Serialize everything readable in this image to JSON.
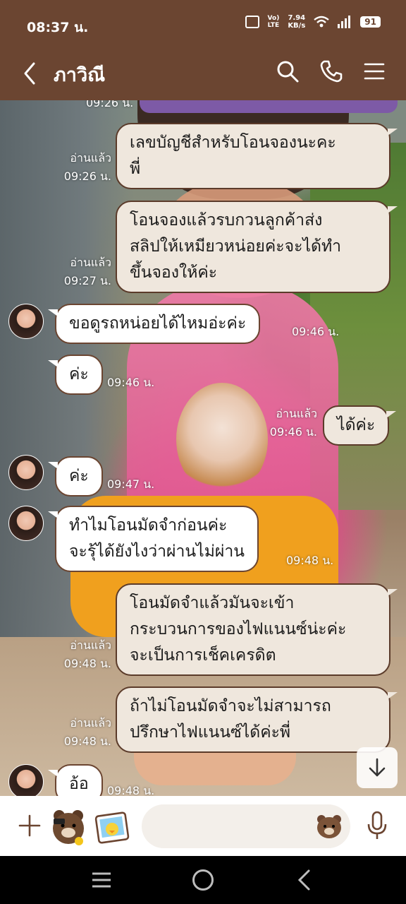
{
  "status_bar": {
    "time": "08:37 น.",
    "volte_top": "Vo)",
    "volte_bottom": "LTE",
    "speed_value": "7.94",
    "speed_unit": "KB/s",
    "battery": "91"
  },
  "header": {
    "title": "ภาวิณี",
    "icons": [
      "back-arrow-icon",
      "search-icon",
      "phone-icon",
      "menu-icon"
    ]
  },
  "messages": [
    {
      "id": "m0",
      "partial_time": "09:26 น."
    },
    {
      "id": "m1",
      "side": "out",
      "lines": [
        "เลขบัญชีสำหรับโอนจองนะคะ",
        "พี่"
      ],
      "read": "อ่านแล้ว",
      "time": "09:26 น."
    },
    {
      "id": "m2",
      "side": "out",
      "lines": [
        "โอนจองแล้วรบกวนลูกค้าส่ง",
        "สลิปให้เหมียวหน่อยค่ะจะได้ทำ",
        "ขึ้นจองให้ค่ะ"
      ],
      "read": "อ่านแล้ว",
      "time": "09:27 น."
    },
    {
      "id": "m3",
      "side": "in",
      "lines": [
        "ขอดูรถหน่อยได้ไหมอ่ะค่ะ"
      ],
      "time": "09:46 น."
    },
    {
      "id": "m4",
      "side": "in",
      "lines": [
        "ค่ะ"
      ],
      "time": "09:46 น."
    },
    {
      "id": "m5",
      "side": "out",
      "lines": [
        "ได้ค่ะ"
      ],
      "read": "อ่านแล้ว",
      "time": "09:46 น."
    },
    {
      "id": "m6",
      "side": "in",
      "lines": [
        "ค่ะ"
      ],
      "time": "09:47 น."
    },
    {
      "id": "m7",
      "side": "in",
      "lines": [
        "ทำไมโอนมัดจำก่อนค่ะ",
        "จะรุ้ได้ยังไงว่าผ่านไม่ผ่าน"
      ],
      "time": "09:48 น."
    },
    {
      "id": "m8",
      "side": "out",
      "lines": [
        "โอนมัดจำแล้วมันจะเข้า",
        "กระบวนการของไฟแนนซ์น่ะค่ะ",
        "จะเป็นการเช็คเครดิต"
      ],
      "read": "อ่านแล้ว",
      "time": "09:48 น."
    },
    {
      "id": "m9",
      "side": "out",
      "lines": [
        "ถ้าไม่โอนมัดจำจะไม่สามารถ",
        "ปรึกษาไฟแนนซ์ได้ค่ะพี่"
      ],
      "read": "อ่านแล้ว",
      "time": "09:48 น."
    },
    {
      "id": "m10",
      "side": "in",
      "lines": [
        "อ้อ"
      ],
      "time": "09:48 น."
    }
  ],
  "input_bar": {
    "placeholder": "",
    "icons": [
      "plus-icon",
      "brown-bear-sticker-icon",
      "sticker-photo-icon",
      "emoji-bear-icon",
      "microphone-icon"
    ]
  },
  "colors": {
    "header_bg": "#6b4531",
    "outgoing_bubble": "#efe7dd",
    "incoming_bubble": "#ffffff",
    "bubble_border": "#6b4531"
  }
}
